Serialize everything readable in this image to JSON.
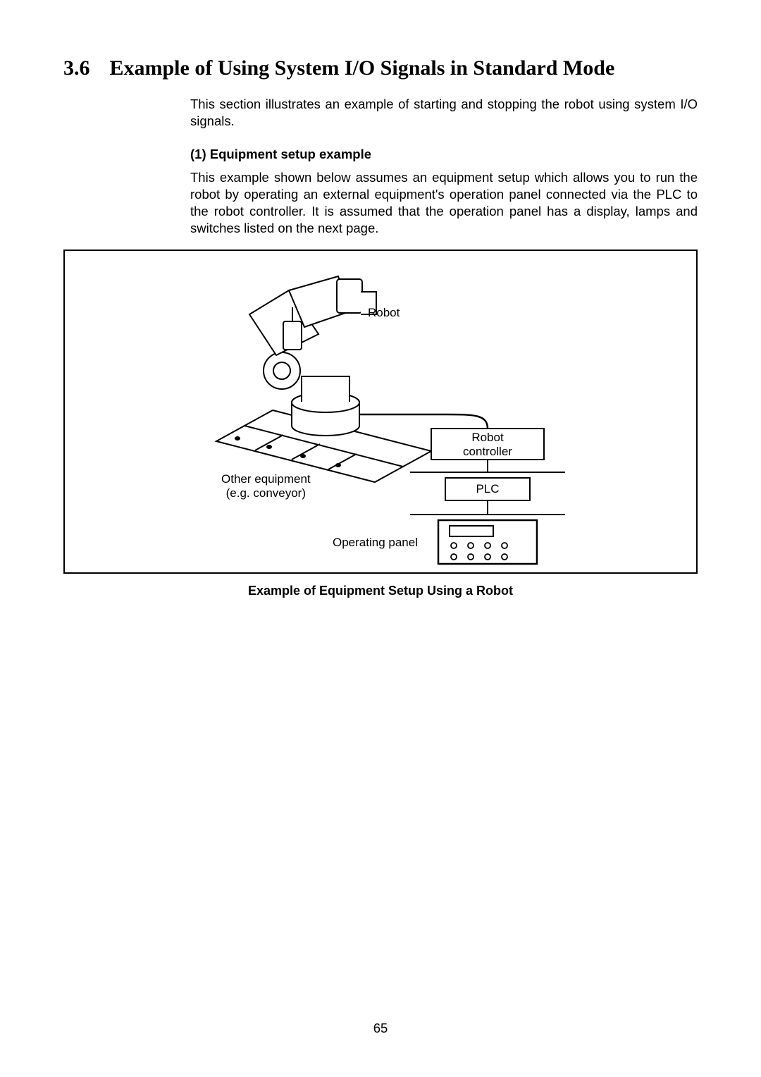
{
  "heading": {
    "number": "3.6",
    "title": "Example of Using System I/O Signals in Standard Mode"
  },
  "intro": "This section illustrates an example of starting and stopping the robot using system I/O signals.",
  "subhead": "(1) Equipment setup example",
  "subpara": "This example shown below assumes an equipment setup which allows you to run the robot by operating an external equipment's operation panel connected via the PLC to the robot controller. It is assumed that the operation panel has a display, lamps and switches listed on the next page.",
  "figure": {
    "labels": {
      "robot": "Robot",
      "controller_line1": "Robot",
      "controller_line2": "controller",
      "plc": "PLC",
      "panel": "Operating panel",
      "other_line1": "Other equipment",
      "other_line2": "(e.g. conveyor)"
    },
    "caption": "Example of Equipment Setup Using a Robot"
  },
  "page_number": "65"
}
